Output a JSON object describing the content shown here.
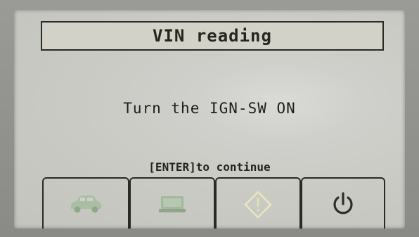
{
  "dialog": {
    "title": "VIN reading",
    "message": "Turn the IGN-SW ON",
    "hint": "[ENTER]to continue"
  },
  "softkeys": [
    {
      "icon": "car-icon"
    },
    {
      "icon": "monitor-icon"
    },
    {
      "icon": "warning-icon"
    },
    {
      "icon": "power-icon"
    }
  ],
  "colors": {
    "screen": "#cfd0cb",
    "text": "#262520",
    "icon_dim": "#9fb59a",
    "warning_icon": "#e6e1b4"
  }
}
